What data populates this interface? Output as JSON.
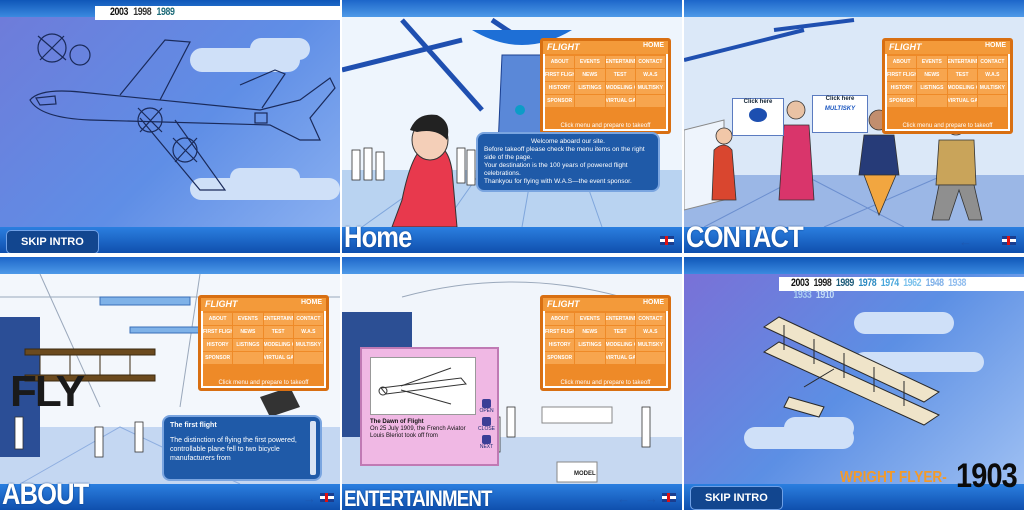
{
  "panel1": {
    "years": [
      "2003",
      "1998",
      "1989"
    ],
    "skip_label": "SKIP INTRO"
  },
  "panel2": {
    "title": "Home",
    "menu": {
      "header_left": "FLIGHT",
      "header_right": "HOME",
      "items": [
        "ABOUT",
        "EVENTS",
        "ENTERTAINMENT",
        "CONTACT",
        "FIRST FLIGHT",
        "NEWS",
        "TEST",
        "W.A.S",
        "HISTORY",
        "LISTINGS",
        "MODELING GAME",
        "MULTISKY",
        "SPONSOR",
        "",
        "VIRTUAL GALLERY",
        ""
      ],
      "footer": "Click menu and prepare to takeoff"
    },
    "bubble_lines": [
      "Welcome aboard our site.",
      "Before takeoff please check the menu items on the right side of the page.",
      "Your destination is the 100 years of powered flight celebrations.",
      "Thankyou for flying with W.A.S—the event sponsor."
    ]
  },
  "panel3": {
    "title": "CONTACT",
    "screen_left": "Click here",
    "screen_right": "Click here",
    "screen_right_logo": "MULTISKY",
    "menu": {
      "header_left": "FLIGHT",
      "header_right": "HOME",
      "items": [
        "ABOUT",
        "EVENTS",
        "ENTERTAINMENT",
        "CONTACT",
        "FIRST FLIGHT",
        "NEWS",
        "TEST",
        "W.A.S",
        "HISTORY",
        "LISTINGS",
        "MODELING GAME",
        "MULTISKY",
        "SPONSOR",
        "",
        "VIRTUAL GALLERY",
        ""
      ],
      "footer": "Click menu and prepare to takeoff"
    }
  },
  "panel4": {
    "title": "ABOUT",
    "wall_text": "FLY",
    "menu": {
      "header_left": "FLIGHT",
      "header_right": "HOME",
      "items": [
        "ABOUT",
        "EVENTS",
        "ENTERTAINMENT",
        "CONTACT",
        "FIRST FLIGHT",
        "NEWS",
        "TEST",
        "W.A.S",
        "HISTORY",
        "LISTINGS",
        "MODELING GAME",
        "MULTISKY",
        "SPONSOR",
        "",
        "VIRTUAL GALLERY",
        ""
      ],
      "footer": "Click menu and prepare to takeoff"
    },
    "info_title": "The first flight",
    "info_text": "The distinction of flying the first powered, controllable plane fell to two bicycle manufacturers from"
  },
  "panel5": {
    "title": "ENTERTAINMENT",
    "menu": {
      "header_left": "FLIGHT",
      "header_right": "HOME",
      "items": [
        "ABOUT",
        "EVENTS",
        "ENTERTAINMENT",
        "CONTACT",
        "FIRST FLIGHT",
        "NEWS",
        "TEST",
        "W.A.S",
        "HISTORY",
        "LISTINGS",
        "MODELING GAME",
        "MULTISKY",
        "SPONSOR",
        "",
        "VIRTUAL GALLERY",
        ""
      ],
      "footer": "Click menu and prepare to takeoff"
    },
    "card_title": "The Dawn of Flight",
    "card_text": "On 25 July 1909, the French Aviator Louis Bleriot took off from",
    "btn_open": "OPEN",
    "btn_close": "CLOSE",
    "btn_next": "NEXT",
    "model_label": "MODEL"
  },
  "panel6": {
    "years": [
      "2003",
      "1998",
      "1989",
      "1978",
      "1974",
      "1962",
      "1948",
      "1938",
      "1933",
      "1910"
    ],
    "caption": "WRIGHT FLYER-",
    "caption_year": "1903",
    "skip_label": "SKIP INTRO"
  },
  "colors": {
    "menu_orange": "#ee8a28",
    "bar_blue": "#1f63c4",
    "bubble_blue": "#1f5aa8",
    "caption_orange": "#f39a2a"
  }
}
